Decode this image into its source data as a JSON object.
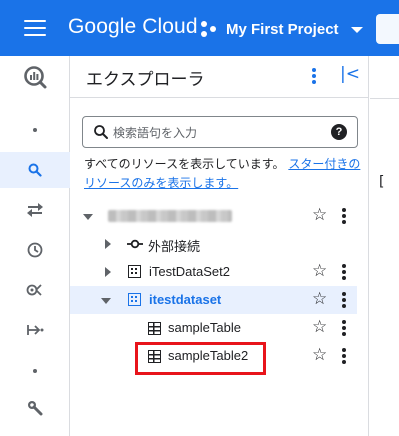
{
  "topbar": {
    "brand": "Google Cloud",
    "project_label": "My First Project",
    "bg_color": "#1a73e8"
  },
  "rail": {
    "items": [
      {
        "icon": "bigquery-logo-icon"
      },
      {
        "icon": "dot-icon"
      },
      {
        "icon": "search-icon",
        "active": true
      },
      {
        "icon": "transfers-icon"
      },
      {
        "icon": "history-icon"
      },
      {
        "icon": "analytics-hub-icon"
      },
      {
        "icon": "pipeline-icon"
      },
      {
        "icon": "dot-icon"
      },
      {
        "icon": "wrench-icon"
      }
    ]
  },
  "explorer": {
    "title": "エクスプローラ",
    "search_placeholder": "検索語句を入力",
    "notice_text": "すべてのリソースを表示しています。",
    "notice_link": "スター付きのリソースのみを表示します。",
    "tree": {
      "project_name_hidden": true,
      "external_connections_label": "外部接続",
      "dataset1_label": "iTestDataSet2",
      "dataset2_label": "itestdataset",
      "table1_label": "sampleTable",
      "table2_label": "sampleTable2"
    },
    "selected_color": "#e8f0fe",
    "highlight_color": "#e8141b"
  },
  "right_peek": {
    "glyph": "["
  }
}
